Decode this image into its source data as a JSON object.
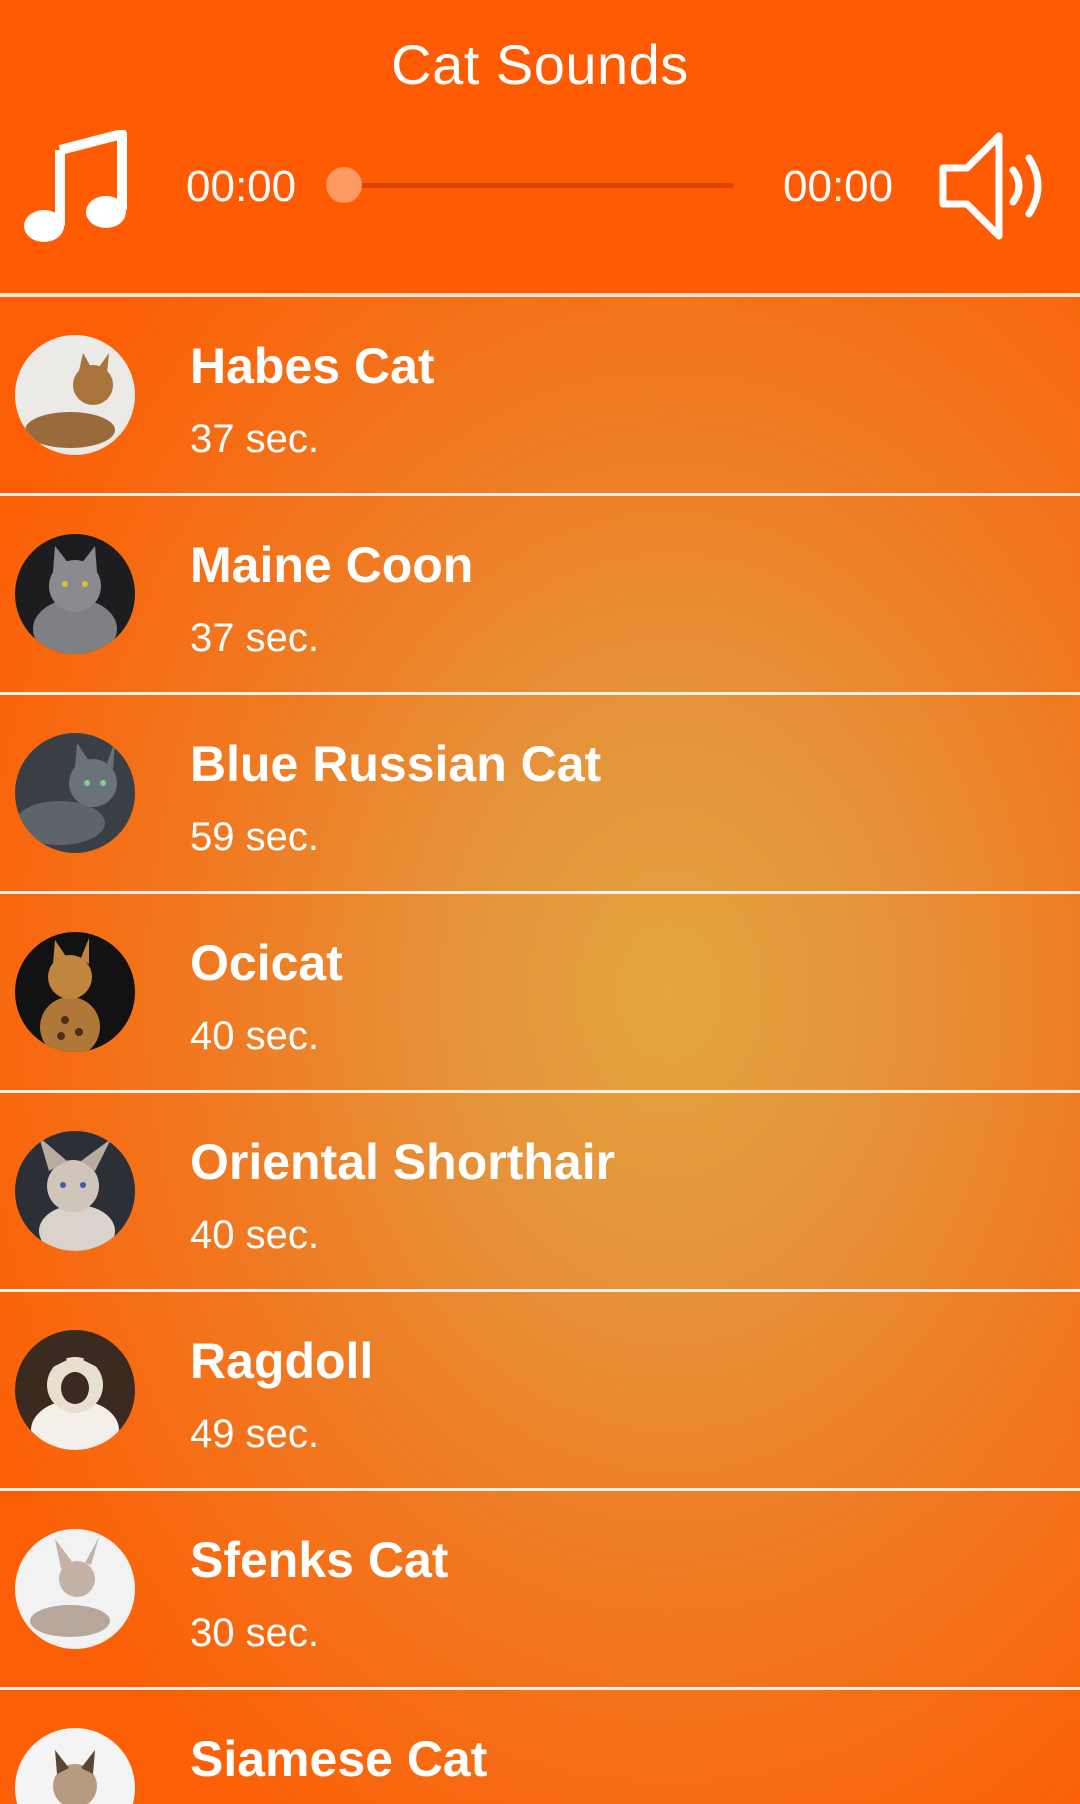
{
  "app": {
    "title": "Cat Sounds"
  },
  "player": {
    "elapsed": "00:00",
    "total": "00:00",
    "progress_fraction": 0,
    "left_icon": "music-note-icon",
    "right_icon": "speaker-volume-icon"
  },
  "colors": {
    "header": "#fe5b02",
    "accent": "#fd9a62",
    "text": "#ffffff"
  },
  "list": {
    "items": [
      {
        "name": "Habes Cat",
        "duration": "37 sec."
      },
      {
        "name": "Maine Coon",
        "duration": "37 sec."
      },
      {
        "name": "Blue Russian Cat",
        "duration": "59 sec."
      },
      {
        "name": "Ocicat",
        "duration": "40 sec."
      },
      {
        "name": "Oriental Shorthair",
        "duration": "40 sec."
      },
      {
        "name": "Ragdoll",
        "duration": "49 sec."
      },
      {
        "name": "Sfenks Cat",
        "duration": "30 sec."
      },
      {
        "name": "Siamese Cat",
        "duration": ""
      }
    ]
  }
}
